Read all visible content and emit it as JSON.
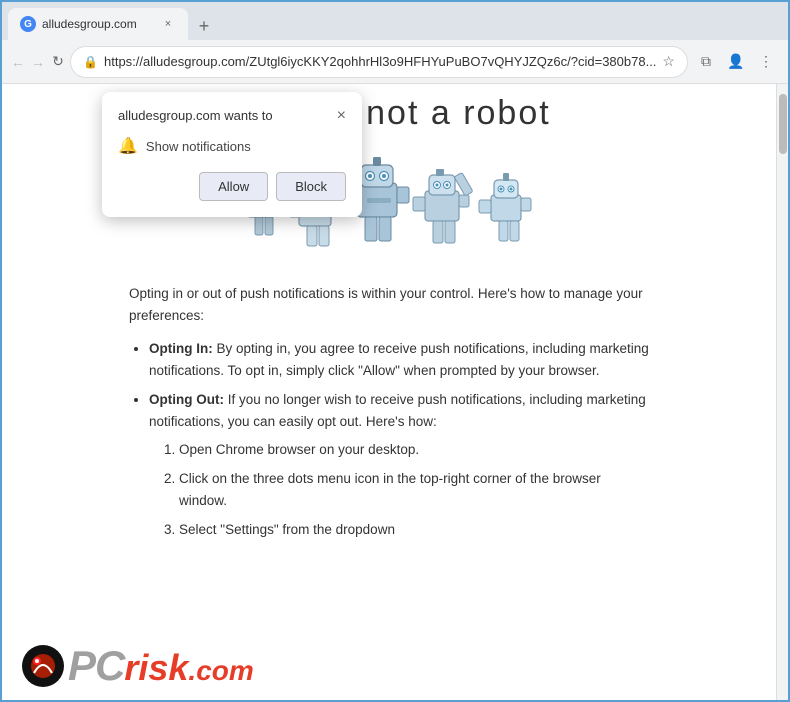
{
  "browser": {
    "tab": {
      "title": "alludesgroup.com",
      "favicon_text": "G"
    },
    "toolbar": {
      "back_label": "←",
      "forward_label": "→",
      "reload_label": "↻",
      "url": "https://alludesgroup.com/ZUtgl6iycKKY2qohhrHl3o9HFHYuPuBO7vQHYJZQz6c/?cid=380b78...",
      "star_label": "☆",
      "profile_label": "👤",
      "menu_label": "⋮",
      "extensions_label": "⧉"
    }
  },
  "notification_popup": {
    "title": "alludesgroup.com wants to",
    "close_label": "×",
    "permission_text": "Show notifications",
    "allow_label": "Allow",
    "block_label": "Block"
  },
  "page": {
    "hero_text": "you are not   a robot",
    "body_intro": "Opting in or out of push notifications is within your control. Here's how to manage your preferences:",
    "bullet1_title": "Opting In:",
    "bullet1_text": " By opting in, you agree to receive push notifications, including marketing notifications. To opt in, simply click \"Allow\" when prompted by your browser.",
    "bullet2_title": "Opting Out:",
    "bullet2_text": " If you no longer wish to receive push notifications, including marketing notifications, you can easily opt out. Here's how:",
    "step1": "Open Chrome browser on your desktop.",
    "step2": "Click on the three dots menu icon in the top-right corner of the browser window.",
    "step3": "Select \"Settings\" from the dropdown"
  },
  "pcrisk": {
    "text_gray": "PC",
    "text_orange": "risk",
    "text_ext": ".com"
  }
}
